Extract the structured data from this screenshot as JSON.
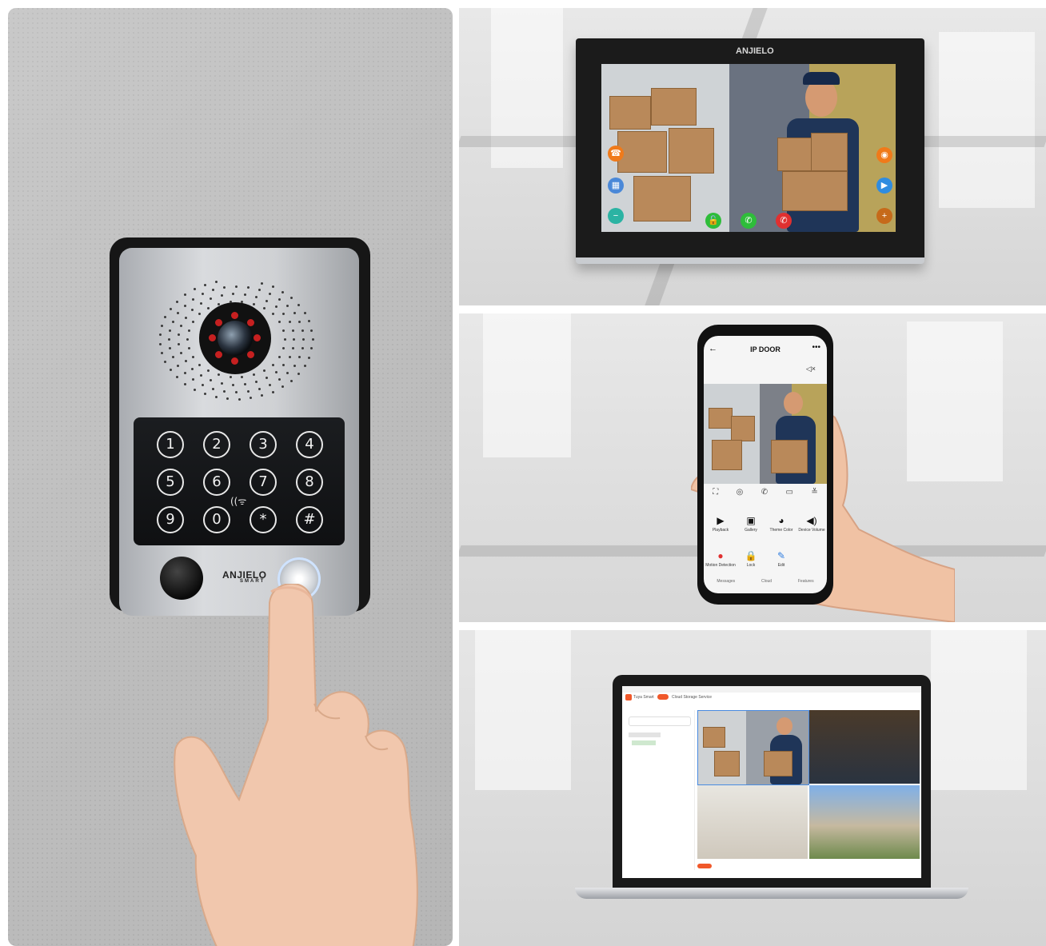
{
  "doorbell": {
    "keys": [
      "1",
      "2",
      "3",
      "4",
      "5",
      "6",
      "7",
      "8",
      "9",
      "0",
      "*",
      "#"
    ],
    "logo_text": "ANJIELO",
    "logo_sub": "SMART",
    "rfid_symbol": "((ᯤ"
  },
  "monitor": {
    "logo_text": "ANJIELO",
    "icons": [
      "contact-icon",
      "apps-icon",
      "zoom-out-icon",
      "unlock-icon",
      "answer-call-icon",
      "hang-up-icon",
      "camera-icon",
      "video-record-icon",
      "zoom-in-icon"
    ]
  },
  "phone_app": {
    "title": "IP DOOR",
    "back_glyph": "←",
    "more_glyph": "•••",
    "grid": [
      {
        "label": "Playback",
        "icon": "▶"
      },
      {
        "label": "Gallery",
        "icon": "▣"
      },
      {
        "label": "Theme Color",
        "icon": "◕"
      },
      {
        "label": "Device Volume",
        "icon": "◀)"
      },
      {
        "label": "Motion Detection",
        "icon": "●"
      },
      {
        "label": "Lock",
        "icon": "🔒"
      },
      {
        "label": "Edit",
        "icon": "✎"
      }
    ],
    "bottom_nav": [
      "Messages",
      "Cloud",
      "Features"
    ]
  },
  "laptop_app": {
    "app_name": "Tuya Smart",
    "tabs": [
      "Cloud Storage Service"
    ]
  },
  "colors": {
    "ir_led": "#c62020",
    "answer_green": "#2ebd3a",
    "hangup_red": "#e03030",
    "monitor_orange": "#f07a1a",
    "laptop_accent": "#f0582a"
  }
}
